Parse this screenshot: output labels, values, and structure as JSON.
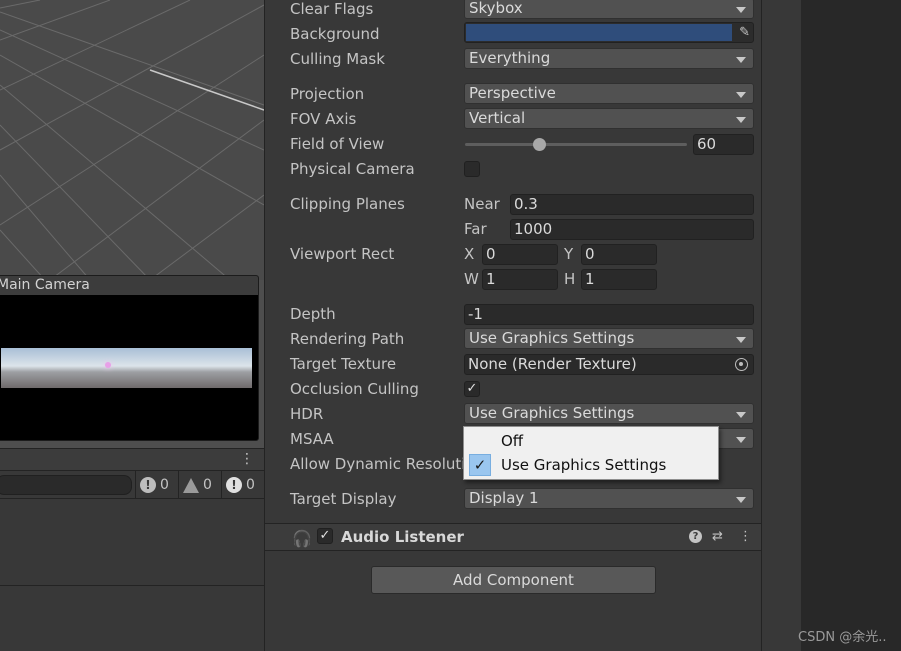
{
  "scene": {
    "camera_preview_title": "Main Camera"
  },
  "console": {
    "menu_icon": "⋮",
    "counts": {
      "info": "0",
      "warning": "0",
      "error": "0"
    }
  },
  "inspector": {
    "clear_flags": {
      "label": "Clear Flags",
      "value": "Skybox"
    },
    "background": {
      "label": "Background",
      "color": "#2f4d7b"
    },
    "culling_mask": {
      "label": "Culling Mask",
      "value": "Everything"
    },
    "projection": {
      "label": "Projection",
      "value": "Perspective"
    },
    "fov_axis": {
      "label": "FOV Axis",
      "value": "Vertical"
    },
    "field_of_view": {
      "label": "Field of View",
      "value": "60"
    },
    "physical_camera": {
      "label": "Physical Camera",
      "checked": false
    },
    "clipping_planes": {
      "label": "Clipping Planes",
      "near_label": "Near",
      "near": "0.3",
      "far_label": "Far",
      "far": "1000"
    },
    "viewport_rect": {
      "label": "Viewport Rect",
      "x_label": "X",
      "x": "0",
      "y_label": "Y",
      "y": "0",
      "w_label": "W",
      "w": "1",
      "h_label": "H",
      "h": "1"
    },
    "depth": {
      "label": "Depth",
      "value": "-1"
    },
    "rendering_path": {
      "label": "Rendering Path",
      "value": "Use Graphics Settings"
    },
    "target_texture": {
      "label": "Target Texture",
      "value": "None (Render Texture)"
    },
    "occlusion_culling": {
      "label": "Occlusion Culling",
      "checked": true,
      "check_glyph": "✓"
    },
    "hdr": {
      "label": "HDR",
      "value": "Use Graphics Settings"
    },
    "msaa": {
      "label": "MSAA"
    },
    "allow_dynamic": {
      "label": "Allow Dynamic Resoluti"
    },
    "target_display": {
      "label": "Target Display",
      "value": "Display 1"
    }
  },
  "popup": {
    "options": [
      "Off",
      "Use Graphics Settings"
    ],
    "selected_index": 1,
    "check_glyph": "✓"
  },
  "audio_listener": {
    "title": "Audio Listener",
    "check_glyph": "✓",
    "enabled": true
  },
  "add_component_label": "Add Component",
  "watermark": "CSDN @余光.."
}
